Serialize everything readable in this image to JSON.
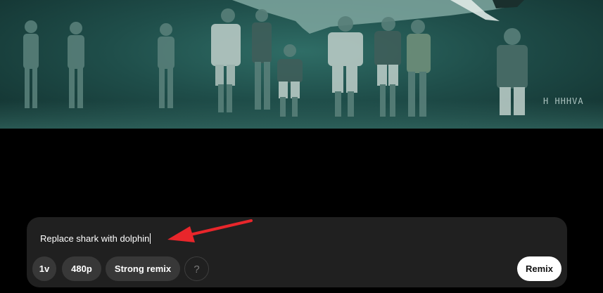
{
  "video": {
    "watermark": "H HHHVA"
  },
  "remix_panel": {
    "prompt_value": "Replace shark with dolphin",
    "chips": {
      "version": "1v",
      "resolution": "480p",
      "strength": "Strong remix",
      "help": "?"
    },
    "remix_button": "Remix"
  },
  "annotation": {
    "arrow_color": "#e8262b"
  },
  "colors": {
    "page_background": "#000000",
    "panel_background": "#202020",
    "chip_background": "#383838",
    "primary_button": "#ffffff"
  }
}
